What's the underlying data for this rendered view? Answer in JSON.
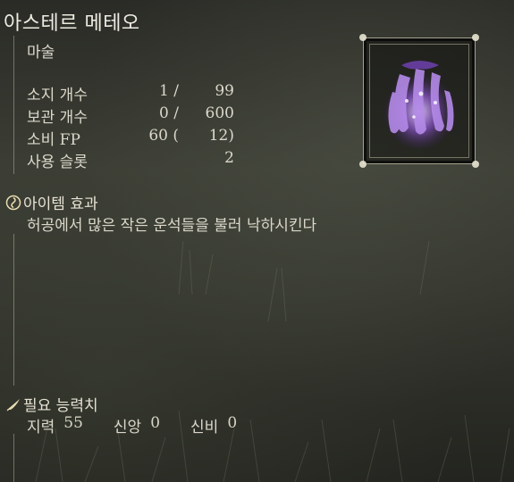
{
  "item": {
    "name": "아스테르 메테오",
    "category": "마술"
  },
  "stats": {
    "held_label": "소지 개수",
    "held": "1 /",
    "held_max": "99",
    "stored_label": "보관 개수",
    "stored": "0 /",
    "stored_max": "600",
    "fp_label": "소비 FP",
    "fp": "60 (",
    "fp_extra": "12)",
    "slots_label": "사용 슬롯",
    "slots": "2"
  },
  "effect": {
    "heading": "아이템 효과",
    "text": "허공에서 많은 작은 운석들을 불러 낙하시킨다"
  },
  "requirements": {
    "heading": "필요 능력치",
    "int_label": "지력",
    "int_value": "55",
    "faith_label": "신앙",
    "faith_value": "0",
    "arcane_label": "신비",
    "arcane_value": "0"
  },
  "icons": {
    "effect": "swirl-orb-icon",
    "requirements": "feather-quill-icon",
    "item": "astral-meteor-spell-icon"
  },
  "colors": {
    "text": "#e8e4d8",
    "spell_purple": "#9b6bd6"
  }
}
